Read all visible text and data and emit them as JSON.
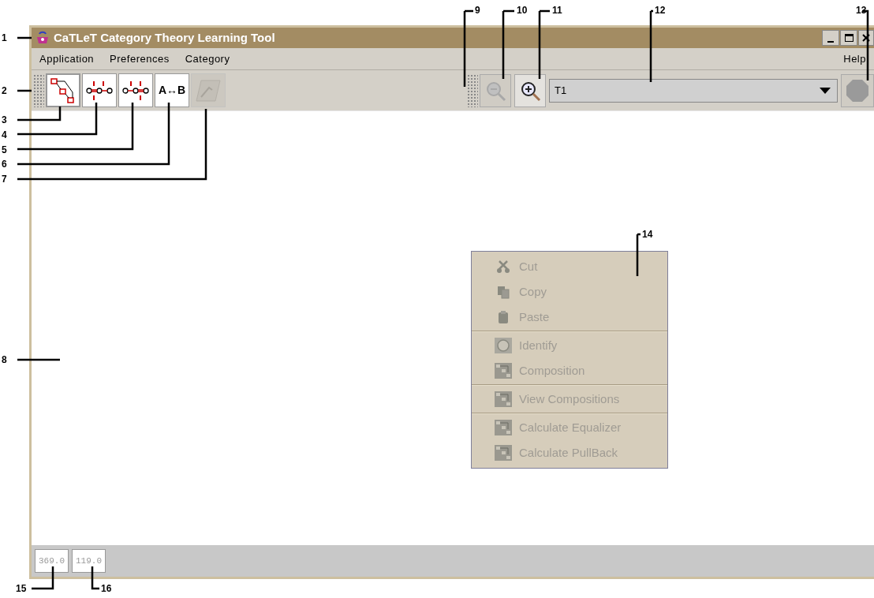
{
  "window": {
    "title": "CaTLeT Category Theory Learning Tool"
  },
  "menu_bar": {
    "items": [
      {
        "label": "Application"
      },
      {
        "label": "Preferences"
      },
      {
        "label": "Category"
      }
    ],
    "help": "Help"
  },
  "toolbar": {
    "tools": [
      {
        "kind": "composition",
        "disabled": false
      },
      {
        "kind": "compose-left",
        "disabled": false
      },
      {
        "kind": "compose-right",
        "disabled": false
      },
      {
        "kind": "text",
        "label": "A↔B",
        "disabled": false
      },
      {
        "kind": "edit",
        "disabled": true
      }
    ],
    "zoom": [
      {
        "kind": "zoom-out",
        "disabled": true
      },
      {
        "kind": "zoom-in",
        "disabled": false
      }
    ],
    "category_select": {
      "value": "T1"
    },
    "stop": {
      "disabled": true
    }
  },
  "context_menu": {
    "groups": [
      [
        {
          "label": "Cut",
          "kind": "cut",
          "disabled": true
        },
        {
          "label": "Copy",
          "kind": "copy",
          "disabled": true
        },
        {
          "label": "Paste",
          "kind": "paste",
          "disabled": true
        }
      ],
      [
        {
          "label": "Identify",
          "kind": "identify",
          "disabled": true
        },
        {
          "label": "Composition",
          "kind": "diagram",
          "disabled": true
        }
      ],
      [
        {
          "label": "View Compositions",
          "kind": "diagram",
          "disabled": true
        }
      ],
      [
        {
          "label": "Calculate Equalizer",
          "kind": "diagram",
          "disabled": true
        },
        {
          "label": "Calculate PullBack",
          "kind": "diagram",
          "disabled": true
        }
      ]
    ]
  },
  "status_bar": {
    "fields": [
      "369.0",
      "119.0"
    ]
  },
  "callouts": [
    "1",
    "2",
    "3",
    "4",
    "5",
    "6",
    "7",
    "8",
    "9",
    "10",
    "11",
    "12",
    "13",
    "14",
    "15",
    "16"
  ]
}
